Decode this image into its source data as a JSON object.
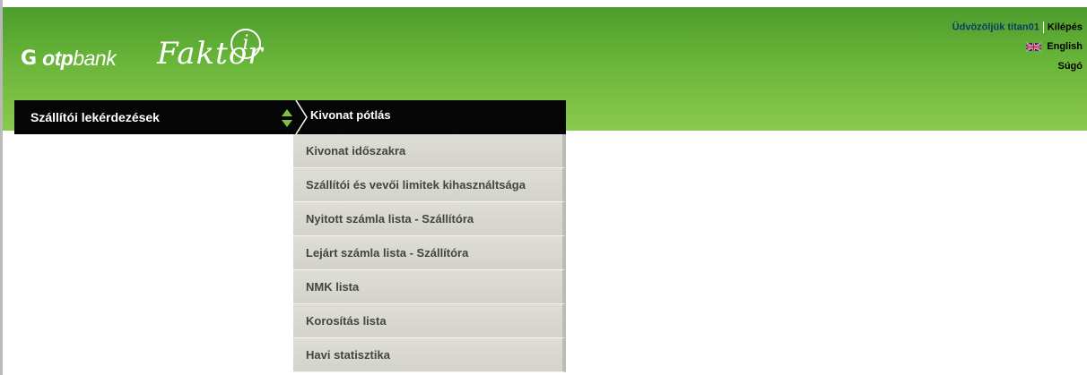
{
  "brand": {
    "mark": "G",
    "otp": "otp",
    "bank": "bank",
    "faktor": "Faktor",
    "faktor_i": "i"
  },
  "user": {
    "welcome": "Üdvözöljük titan01",
    "logout": "Kilépés",
    "language": "English",
    "help": "Súgó"
  },
  "nav": {
    "section_title": "Szállítói lekérdezések",
    "current": "Kivonat pótlás",
    "items": [
      {
        "label": "Kivonat időszakra"
      },
      {
        "label": "Szállítói és vevői limitek kihasználtsága"
      },
      {
        "label": "Nyitott számla lista - Szállítóra"
      },
      {
        "label": "Lejárt számla lista - Szállítóra"
      },
      {
        "label": "NMK lista"
      },
      {
        "label": "Korosítás lista"
      },
      {
        "label": "Havi statisztika"
      }
    ]
  },
  "colors": {
    "header_green": "#66b338",
    "nav_black": "#050505",
    "arrow_green": "#7dc242",
    "menu_item": "#d8d8d0"
  }
}
